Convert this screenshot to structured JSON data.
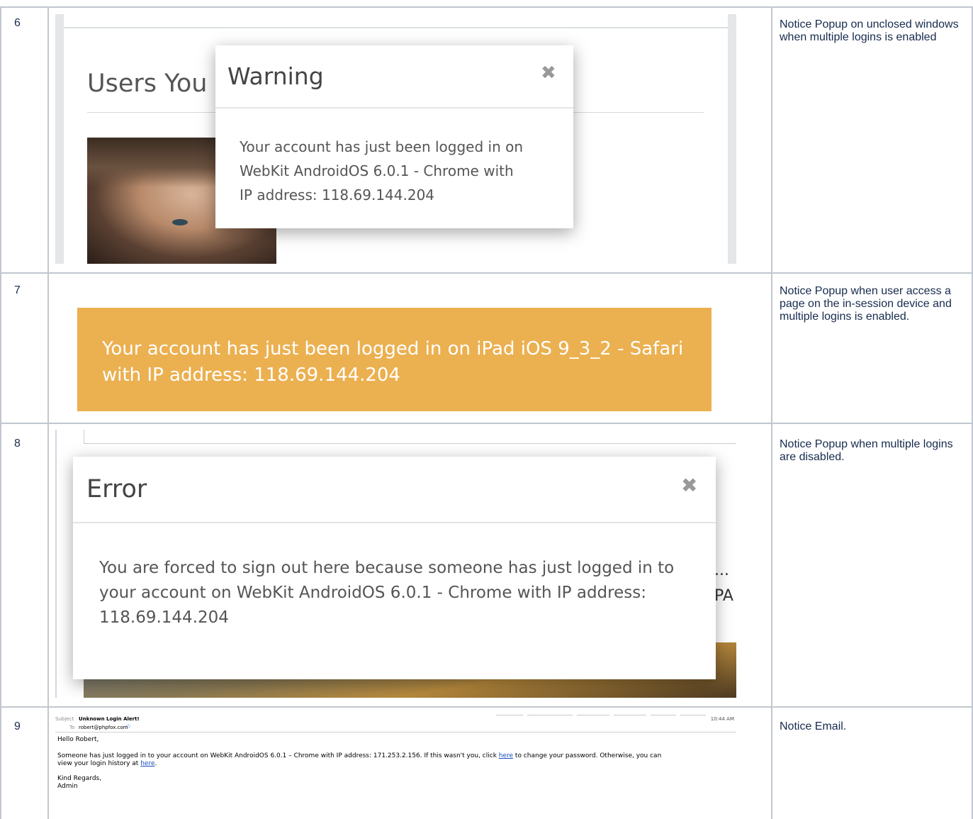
{
  "rows": [
    {
      "number": "6",
      "description": "Notice Popup on unclosed windows when multiple logins is enabled"
    },
    {
      "number": "7",
      "description": "Notice Popup when user access a page on the in-session device and multiple logins is enabled."
    },
    {
      "number": "8",
      "description": "Notice Popup when multiple logins are disabled."
    },
    {
      "number": "9",
      "description": "Notice Email."
    }
  ],
  "row6": {
    "background_title": "Users You",
    "modal_title": "Warning",
    "close_glyph": "✖",
    "body": [
      "Your account has just been logged in on",
      "WebKit AndroidOS 6.0.1 - Chrome with",
      "IP address: 118.69.144.204"
    ]
  },
  "row7": {
    "alert_text": "Your account has just been logged in on iPad iOS 9_3_2 - Safari with IP address: 118.69.144.204",
    "alert_color": "#ebb050"
  },
  "row8": {
    "modal_title": "Error",
    "close_glyph": "✖",
    "body": [
      "You are forced to sign out here because someone has just logged in to",
      "your account on WebKit AndroidOS 6.0.1 - Chrome with IP address:",
      "118.69.144.204"
    ],
    "bg_text_1": "...",
    "bg_text_2": "PA"
  },
  "email": {
    "subject_label": "Subject",
    "subject": "Unknown Login Alert!",
    "to_label": "To",
    "to": "robert@phpfox.com",
    "star": "☆",
    "time": "10:44 AM",
    "greeting": "Hello Robert,",
    "body_part1": "Someone has just logged in to your account on WebKit AndroidOS 6.0.1 – Chrome with IP address: 171.253.2.156. If this wasn't you, click ",
    "link1": "here",
    "body_part2": " to change your password. Otherwise, you can",
    "body_line2": "view your login history at ",
    "link2": "here",
    "body_end": ".",
    "closing": "Kind Regards,",
    "signature": "Admin"
  }
}
